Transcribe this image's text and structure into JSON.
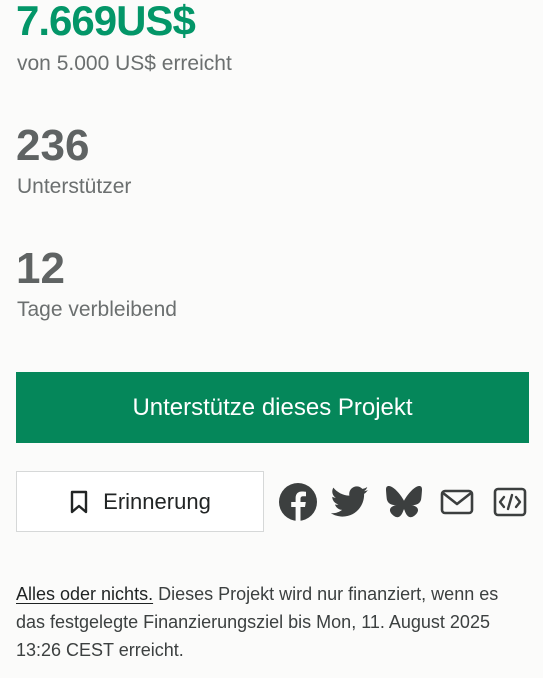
{
  "stats": {
    "pledged_amount": "7.669US$",
    "pledged_label": "von 5.000 US$ erreicht",
    "backers_count": "236",
    "backers_label": "Unterstützer",
    "days_count": "12",
    "days_label": "Tage verbleibend"
  },
  "actions": {
    "back_project_label": "Unterstütze dieses Projekt",
    "remind_label": "Erinnerung"
  },
  "share": {
    "icons": [
      "facebook-icon",
      "twitter-icon",
      "bluesky-icon",
      "email-icon",
      "embed-icon"
    ]
  },
  "footnote": {
    "all_or_nothing_link": "Alles oder nichts.",
    "text": " Dieses Projekt wird nur finanziert, wenn es das festgelegte Finanzierungsziel bis Mon, 11. August 2025 13:26 CEST erreicht."
  },
  "colors": {
    "accent_green": "#039668",
    "button_green": "#05875a",
    "background": "#fbfbfa",
    "icon_dark": "#3c3f3f"
  }
}
